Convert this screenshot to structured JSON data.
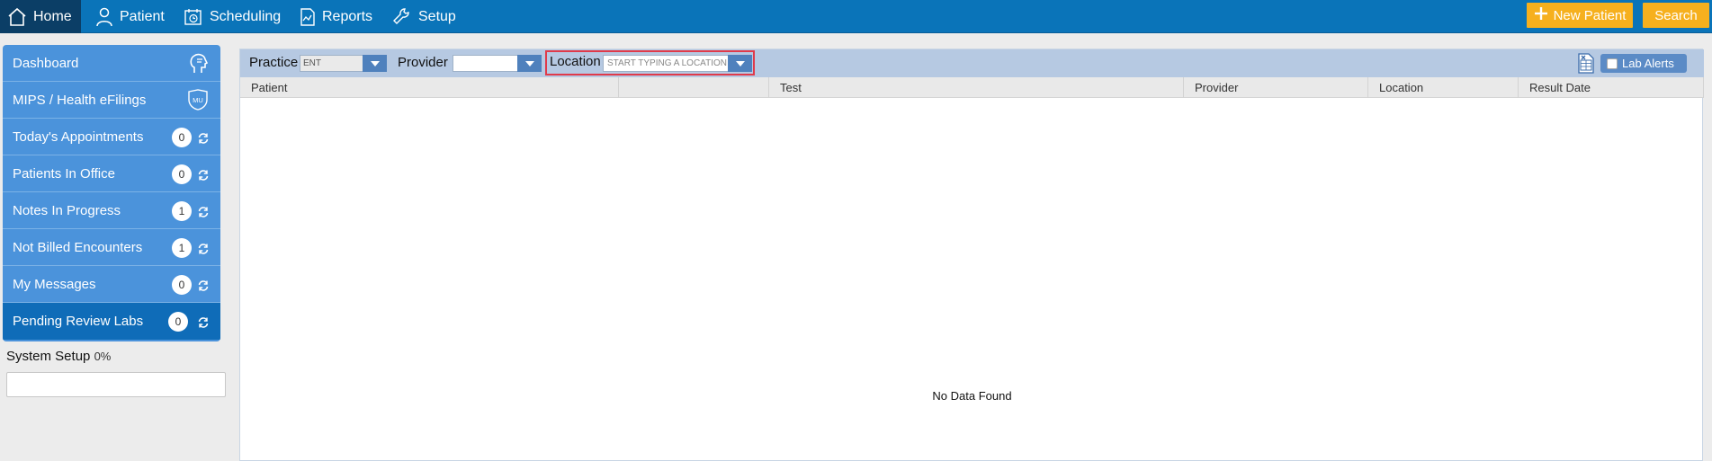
{
  "nav": {
    "home": "Home",
    "patient": "Patient",
    "scheduling": "Scheduling",
    "reports": "Reports",
    "setup": "Setup",
    "new_patient": "New Patient",
    "search": "Search"
  },
  "sidebar": {
    "items": [
      {
        "label": "Dashboard"
      },
      {
        "label": "MIPS / Health eFilings"
      },
      {
        "label": "Today's Appointments",
        "count": "0"
      },
      {
        "label": "Patients In Office",
        "count": "0"
      },
      {
        "label": "Notes In Progress",
        "count": "1"
      },
      {
        "label": "Not Billed Encounters",
        "count": "1"
      },
      {
        "label": "My Messages",
        "count": "0"
      },
      {
        "label": "Pending Review Labs",
        "count": "0"
      }
    ],
    "system_setup_label": "System Setup",
    "system_setup_percent": "0%",
    "mips_badge": "MU"
  },
  "filters": {
    "practice_label": "Practice",
    "practice_value": "ENT",
    "provider_label": "Provider",
    "provider_value": "",
    "location_label": "Location",
    "location_placeholder": "START TYPING A LOCATION",
    "lab_alerts": "Lab Alerts"
  },
  "table": {
    "columns": [
      "Patient",
      "",
      "Test",
      "Provider",
      "Location",
      "Result Date"
    ],
    "empty_text": "No Data Found"
  },
  "colors": {
    "topbar": "#0a74b9",
    "accent": "#f6b01e",
    "sidebar": "#4b93db",
    "sidebar_active": "#0f6cb8",
    "highlight": "#e03a4a"
  }
}
